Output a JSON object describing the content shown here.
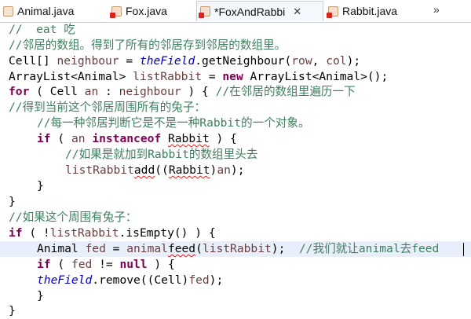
{
  "tabs": [
    {
      "label": "Animal.java",
      "icon": "java-file-icon",
      "active": false
    },
    {
      "label": "Fox.java",
      "icon": "java-file-error-icon",
      "active": false
    },
    {
      "label": "*FoxAndRabbi",
      "icon": "java-file-error-icon",
      "active": true,
      "close": "✕"
    },
    {
      "label": "Rabbit.java",
      "icon": "java-file-error-icon",
      "active": false
    }
  ],
  "overflow": "»",
  "code": {
    "l0": "//  eat 吃",
    "l1": "//邻居的数组。得到了所有的邻居存到邻居的数组里。",
    "l2": {
      "a": "Cell[] ",
      "b": "neighbour",
      "c": " = ",
      "d": "theField",
      "e": ".getNeighbour(",
      "f": "row",
      ",": ", ",
      "g": "col",
      "h": ");"
    },
    "l3": {
      "a": "ArrayList<Animal> ",
      "b": "listRabbit",
      "c": " = ",
      "d": "new",
      "e": " ArrayList<Animal>();"
    },
    "l4": {
      "a": "for",
      "b": " ( Cell ",
      "c": "an",
      "d": " : ",
      "e": "neighbour",
      "f": " ) { ",
      "g": "//在邻居的数组里遍历一下"
    },
    "l5": "//得到当前这个邻居周围所有的兔子：",
    "l6": "//每一种邻居判断它是不是一种Rabbit的一个对象。",
    "l7": {
      "a": "if",
      "b": " ( ",
      "c": "an",
      "d": " ",
      "e": "instanceof",
      "f": " ",
      "g": "Rabbit",
      "h": " ) {"
    },
    "l8": "//如果是就加到Rabbit的数组里头去",
    "l9": {
      "a": "listRabbit",
      ".": ".",
      "b": "add",
      "c": "((",
      "d": "Rabbit",
      "e": ")",
      "f": "an",
      "g": ");"
    },
    "l10": "}",
    "l11": "}",
    "l12": "//如果这个周围有兔子：",
    "l13": {
      "a": "if",
      "b": " ( !",
      "c": "listRabbit",
      "d": ".isEmpty() ) {"
    },
    "l14": {
      "a": "Animal ",
      "b": "fed",
      "c": " = ",
      "d": "animal",
      ".": ".",
      "e": "feed",
      "f": "(",
      "g": "listRabbit",
      "h": ");  ",
      "i": "//我们就让animal去feed"
    },
    "l15": {
      "a": "if",
      "b": " ( ",
      "c": "fed",
      "d": " != ",
      "e": "null",
      "f": " ) {"
    },
    "l16": {
      "a": "theField",
      "b": ".remove((Cell)",
      "c": "fed",
      "d": ");"
    },
    "l17": "}",
    "l18": "}"
  }
}
